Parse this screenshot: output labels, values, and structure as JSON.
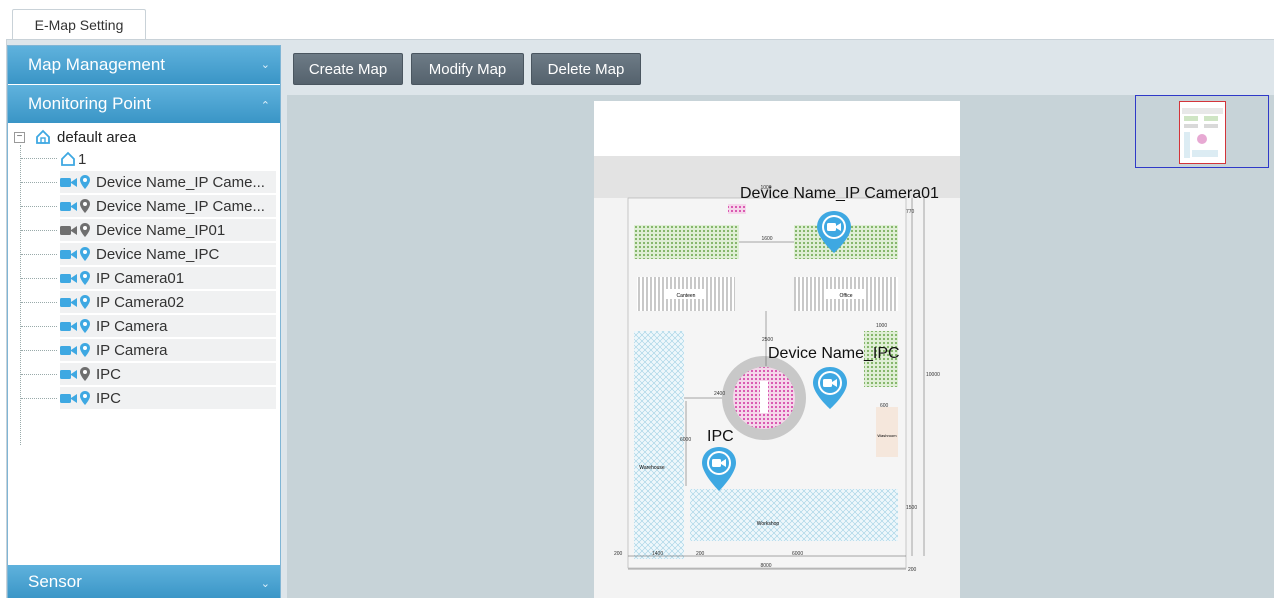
{
  "tab": {
    "label": "E-Map Setting"
  },
  "sidebar": {
    "sections": [
      {
        "label": "Map Management",
        "state": "collapsed"
      },
      {
        "label": "Monitoring Point",
        "state": "expanded"
      },
      {
        "label": "Sensor",
        "state": "collapsed"
      }
    ],
    "tree": {
      "root": {
        "label": "default area",
        "expander": "⊟"
      },
      "items": [
        {
          "label": "1",
          "type": "area",
          "pin": ""
        },
        {
          "label": "Device Name_IP Came...",
          "type": "camera",
          "pin": "blue"
        },
        {
          "label": "Device Name_IP Came...",
          "type": "camera",
          "pin": "gray"
        },
        {
          "label": "Device Name_IP01",
          "type": "camera-offline",
          "pin": "gray"
        },
        {
          "label": "Device Name_IPC",
          "type": "camera",
          "pin": "blue"
        },
        {
          "label": "IP Camera01",
          "type": "camera",
          "pin": "blue"
        },
        {
          "label": "IP Camera02",
          "type": "camera",
          "pin": "blue"
        },
        {
          "label": "IP Camera",
          "type": "camera",
          "pin": "blue"
        },
        {
          "label": "IP Camera",
          "type": "camera",
          "pin": "blue"
        },
        {
          "label": "IPC",
          "type": "camera",
          "pin": "gray"
        },
        {
          "label": "IPC",
          "type": "camera",
          "pin": "blue"
        }
      ]
    }
  },
  "toolbar": {
    "create_label": "Create Map",
    "modify_label": "Modify Map",
    "delete_label": "Delete Map"
  },
  "map": {
    "camera_labels": [
      "Device Name_IP Camera01",
      "Device Name_IPC",
      "IPC"
    ],
    "zones": [
      "Canteen",
      "Office",
      "Warehouse",
      "Workshop",
      "Washroom"
    ],
    "dimensions": [
      "1000",
      "1600",
      "2500",
      "2400",
      "1000",
      "600",
      "6000",
      "200",
      "1400",
      "200",
      "6000",
      "8000",
      "200",
      "10000",
      "770",
      "1500"
    ]
  },
  "colors": {
    "accent": "#4aa6d6",
    "camera_blue": "#3ea8e2",
    "pin_gray": "#6f6f6f",
    "toolbar_button": "#5f6c77",
    "map_background": "#c7d3d8"
  },
  "icons": {
    "camera": "camera-icon",
    "pin": "location-pin-icon",
    "home": "home-icon"
  }
}
